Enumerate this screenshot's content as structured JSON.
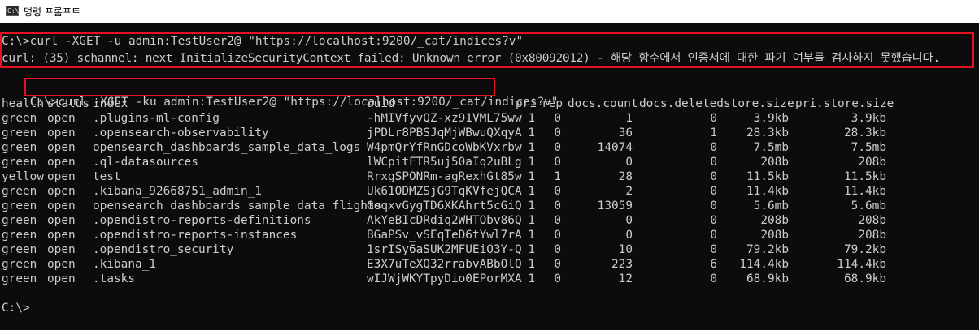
{
  "window": {
    "title": "명령 프롬프트",
    "app_icon": "cmd-icon"
  },
  "colors": {
    "highlight": "#e81123",
    "text": "#cccccc",
    "background": "#0c0c0c"
  },
  "console": {
    "cmd1": "C:\\>curl -XGET -u admin:TestUser2@ \"https://localhost:9200/_cat/indices?v\"",
    "error": "curl: (35) schannel: next InitializeSecurityContext failed: Unknown error (0x80092012) - 해당 함수에서 인증서에 대한 파기 여부를 검사하지 못했습니다.",
    "prompt2": "C:\\>",
    "cmd2": "curl -XGET -ku admin:TestUser2@ \"https://localhost:9200/_cat/indices?v\"",
    "final_prompt": "C:\\>"
  },
  "table": {
    "headers": [
      "health",
      "status",
      "index",
      "uuid",
      "pri",
      "rep",
      "docs.count",
      "docs.deleted",
      "store.size",
      "pri.store.size"
    ],
    "rows": [
      [
        "green",
        "open",
        ".plugins-ml-config",
        "-hMIVfyvQZ-xz91VML75ww",
        "1",
        "0",
        "1",
        "0",
        "3.9kb",
        "3.9kb"
      ],
      [
        "green",
        "open",
        ".opensearch-observability",
        "jPDLr8PBSJqMjWBwuQXqyA",
        "1",
        "0",
        "36",
        "1",
        "28.3kb",
        "28.3kb"
      ],
      [
        "green",
        "open",
        "opensearch_dashboards_sample_data_logs",
        "W4pmQrYfRnGDcoWbKVxrbw",
        "1",
        "0",
        "14074",
        "0",
        "7.5mb",
        "7.5mb"
      ],
      [
        "green",
        "open",
        ".ql-datasources",
        "lWCpitFTR5uj50aIq2uBLg",
        "1",
        "0",
        "0",
        "0",
        "208b",
        "208b"
      ],
      [
        "yellow",
        "open",
        "test",
        "RrxgSPONRm-agRexhGt85w",
        "1",
        "1",
        "28",
        "0",
        "11.5kb",
        "11.5kb"
      ],
      [
        "green",
        "open",
        ".kibana_92668751_admin_1",
        "Uk61ODMZSjG9TqKVfejQCA",
        "1",
        "0",
        "2",
        "0",
        "11.4kb",
        "11.4kb"
      ],
      [
        "green",
        "open",
        "opensearch_dashboards_sample_data_flights",
        "GoqxvGygTD6XKAhrt5cGiQ",
        "1",
        "0",
        "13059",
        "0",
        "5.6mb",
        "5.6mb"
      ],
      [
        "green",
        "open",
        ".opendistro-reports-definitions",
        "AkYeBIcDRdiq2WHTObv86Q",
        "1",
        "0",
        "0",
        "0",
        "208b",
        "208b"
      ],
      [
        "green",
        "open",
        ".opendistro-reports-instances",
        "BGaPSv_vSEqTeD6tYwl7rA",
        "1",
        "0",
        "0",
        "0",
        "208b",
        "208b"
      ],
      [
        "green",
        "open",
        ".opendistro_security",
        "1srISy6aSUK2MFUEiO3Y-Q",
        "1",
        "0",
        "10",
        "0",
        "79.2kb",
        "79.2kb"
      ],
      [
        "green",
        "open",
        ".kibana_1",
        "E3X7uTeXQ32rrabvABbOlQ",
        "1",
        "0",
        "223",
        "6",
        "114.4kb",
        "114.4kb"
      ],
      [
        "green",
        "open",
        ".tasks",
        "wIJWjWKYTpyDio0EPorMXA",
        "1",
        "0",
        "12",
        "0",
        "68.9kb",
        "68.9kb"
      ]
    ]
  }
}
